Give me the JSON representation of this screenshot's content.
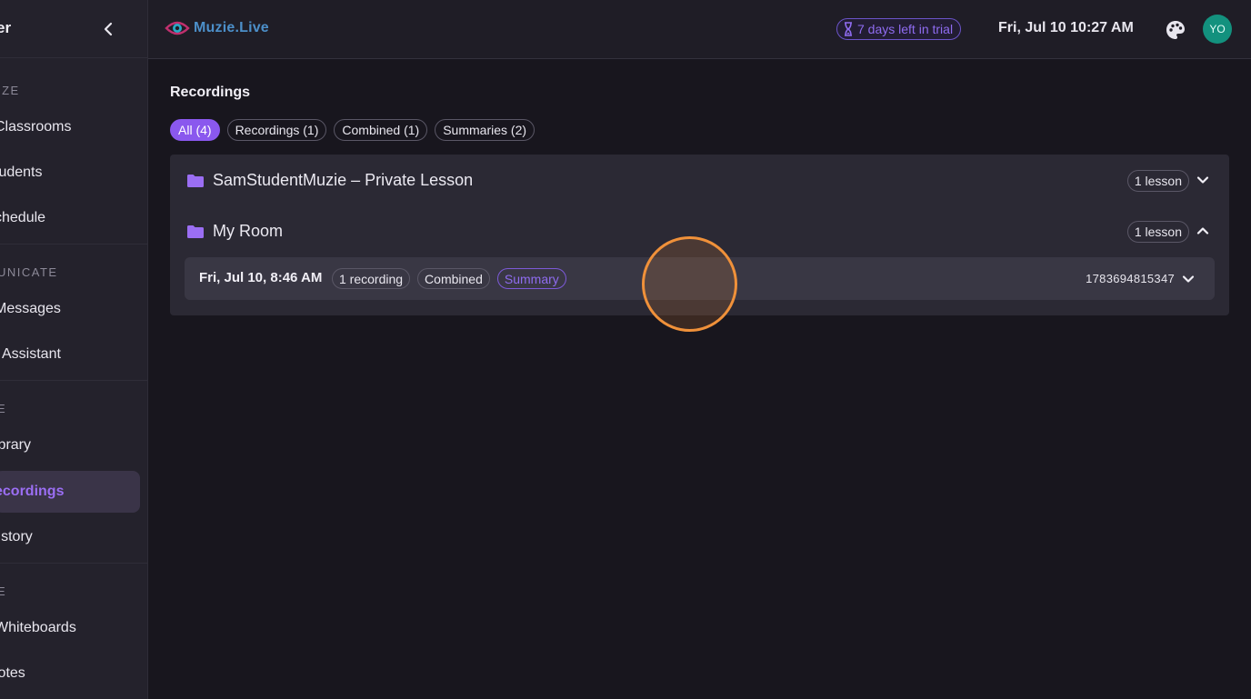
{
  "sidebar": {
    "title": "er",
    "sections": [
      {
        "label": "IZE",
        "items": [
          {
            "label": "Classrooms"
          },
          {
            "label": "tudents"
          },
          {
            "label": "chedule"
          }
        ]
      },
      {
        "label": "UNICATE",
        "items": [
          {
            "label": "Messages"
          },
          {
            "label": "I Assistant"
          }
        ]
      },
      {
        "label": "E",
        "items": [
          {
            "label": "ibrary"
          },
          {
            "label": "ecordings",
            "active": true
          },
          {
            "label": "listory"
          }
        ]
      },
      {
        "label": "E",
        "items": [
          {
            "label": "Whiteboards"
          },
          {
            "label": "lotes"
          }
        ]
      }
    ]
  },
  "topbar": {
    "logo_text": "Muzie.Live",
    "trial_text": "7 days left in trial",
    "datetime": "Fri, Jul 10 10:27 AM",
    "avatar_initials": "YO"
  },
  "main": {
    "title": "Recordings",
    "filters": [
      {
        "label": "All (4)",
        "active": true
      },
      {
        "label": "Recordings (1)"
      },
      {
        "label": "Combined (1)"
      },
      {
        "label": "Summaries (2)"
      }
    ],
    "groups": [
      {
        "name": "SamStudentMuzie – Private Lesson",
        "badge": "1 lesson",
        "expanded": false
      },
      {
        "name": "My Room",
        "badge": "1 lesson",
        "expanded": true,
        "recordings": [
          {
            "date": "Fri, Jul 10, 8:46 AM",
            "tags": [
              "1 recording",
              "Combined",
              "Summary"
            ],
            "id": "1783694815347"
          }
        ]
      }
    ]
  },
  "colors": {
    "accent": "#8a58ee",
    "background": "#18161e",
    "sidebar": "#24222c",
    "panel": "#2b2934",
    "avatar": "#13917e",
    "click_indicator": "#f0913a"
  }
}
